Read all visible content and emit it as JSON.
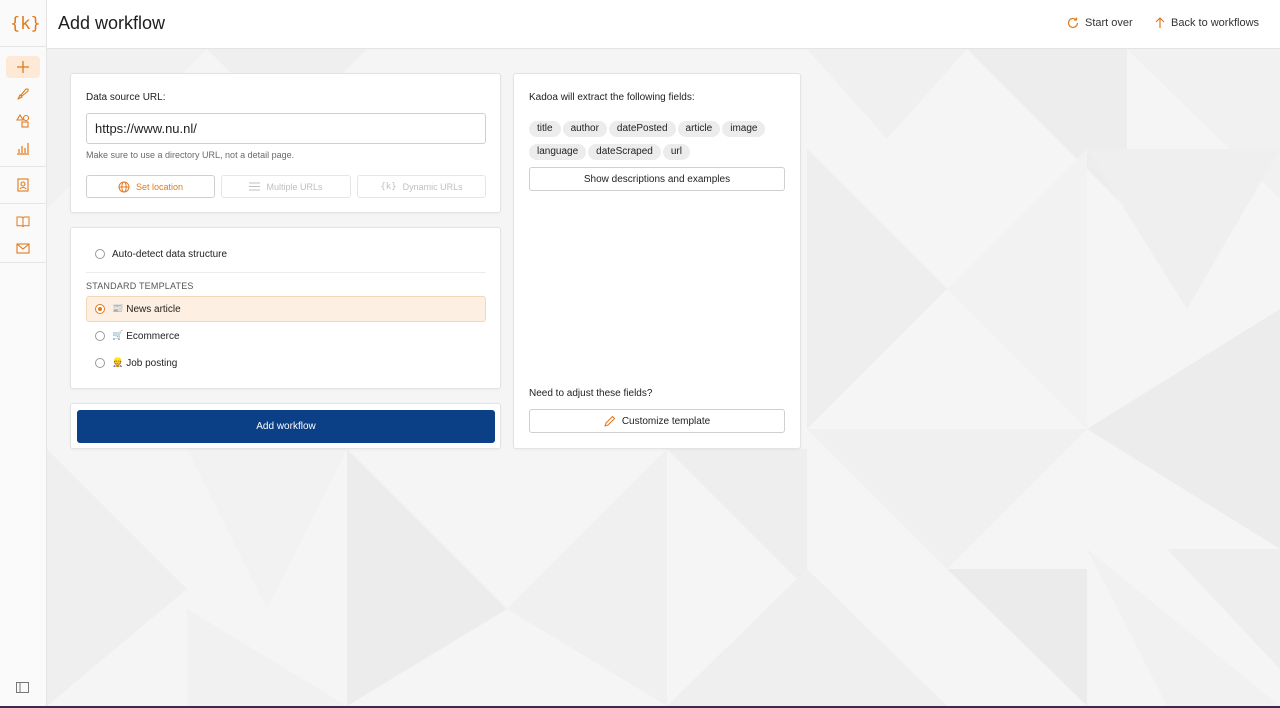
{
  "app": {
    "logo": "{k}",
    "accent_color": "#e07a1f",
    "primary_button_color": "#0b3f86"
  },
  "header": {
    "title": "Add workflow",
    "start_over_label": "Start over",
    "back_label": "Back to workflows"
  },
  "sidebar": {
    "items": [
      {
        "icon": "plus-icon",
        "active": true
      },
      {
        "icon": "rocket-icon",
        "active": false
      },
      {
        "icon": "shapes-icon",
        "active": false
      },
      {
        "icon": "bar-chart-icon",
        "active": false
      },
      {
        "icon": "contact-card-icon",
        "active": false
      },
      {
        "icon": "book-icon",
        "active": false
      },
      {
        "icon": "mail-icon",
        "active": false
      }
    ],
    "collapse_icon": "sidebar-toggle-icon"
  },
  "source": {
    "label": "Data source URL:",
    "url_value": "https://www.nu.nl/",
    "hint": "Make sure to use a directory URL, not a detail page.",
    "set_location_label": "Set location",
    "multiple_urls_label": "Multiple URLs",
    "dynamic_urls_label": "Dynamic URLs"
  },
  "structure": {
    "auto_detect_label": "Auto-detect data structure",
    "templates_heading": "STANDARD TEMPLATES",
    "templates": [
      {
        "emoji": "📰",
        "label": "News article",
        "selected": true
      },
      {
        "emoji": "🛒",
        "label": "Ecommerce",
        "selected": false
      },
      {
        "emoji": "👷",
        "label": "Job posting",
        "selected": false
      }
    ]
  },
  "submit": {
    "label": "Add workflow"
  },
  "fields_panel": {
    "heading": "Kadoa will extract the following fields:",
    "fields": [
      "title",
      "author",
      "datePosted",
      "article",
      "image",
      "language",
      "dateScraped",
      "url"
    ],
    "show_descriptions_label": "Show descriptions and examples",
    "adjust_prompt": "Need to adjust these fields?",
    "customize_label": "Customize template"
  }
}
